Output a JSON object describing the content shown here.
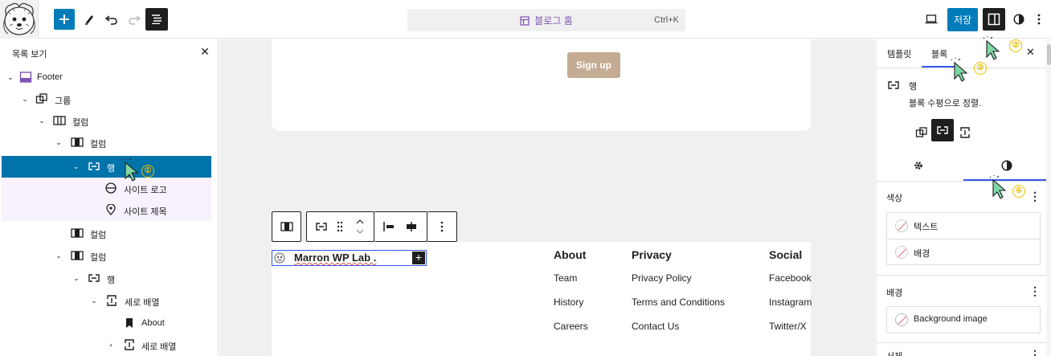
{
  "topbar": {
    "command_title": "블로그 홈",
    "command_shortcut": "Ctrl+K",
    "save_label": "저장"
  },
  "list_view": {
    "title": "목록 보기",
    "rows": [
      {
        "label": "Footer"
      },
      {
        "label": "그룹"
      },
      {
        "label": "컬럼"
      },
      {
        "label": "컬럼"
      },
      {
        "label": "행"
      },
      {
        "label": "사이트 로고"
      },
      {
        "label": "사이트 제목"
      },
      {
        "label": "컬럼"
      },
      {
        "label": "컬럼"
      },
      {
        "label": "행"
      },
      {
        "label": "세로 배열"
      },
      {
        "label": "About"
      },
      {
        "label": "세로 배열"
      }
    ]
  },
  "canvas": {
    "signup_label": "Sign up",
    "site_title": "Marron WP Lab .",
    "columns": [
      {
        "heading": "About",
        "links": [
          "Team",
          "History",
          "Careers"
        ]
      },
      {
        "heading": "Privacy",
        "links": [
          "Privacy Policy",
          "Terms and Conditions",
          "Contact Us"
        ]
      },
      {
        "heading": "Social",
        "links": [
          "Facebook",
          "Instagram",
          "Twitter/X"
        ]
      }
    ]
  },
  "sidebar": {
    "tab_template": "템플릿",
    "tab_block": "블록",
    "block_name": "행",
    "block_desc": "블록 수평으로 정렬.",
    "color_section": "색상",
    "color_text": "텍스트",
    "color_background": "배경",
    "background_section": "배경",
    "background_image": "Background image",
    "next_section": "서체"
  },
  "annotations": [
    "①",
    "②",
    "③",
    "④"
  ],
  "colors": {
    "accent": "#007cba",
    "selection": "#0073aa",
    "purple": "#7f54b3",
    "signup": "#c4ab93",
    "annotation": "#e6c200"
  }
}
